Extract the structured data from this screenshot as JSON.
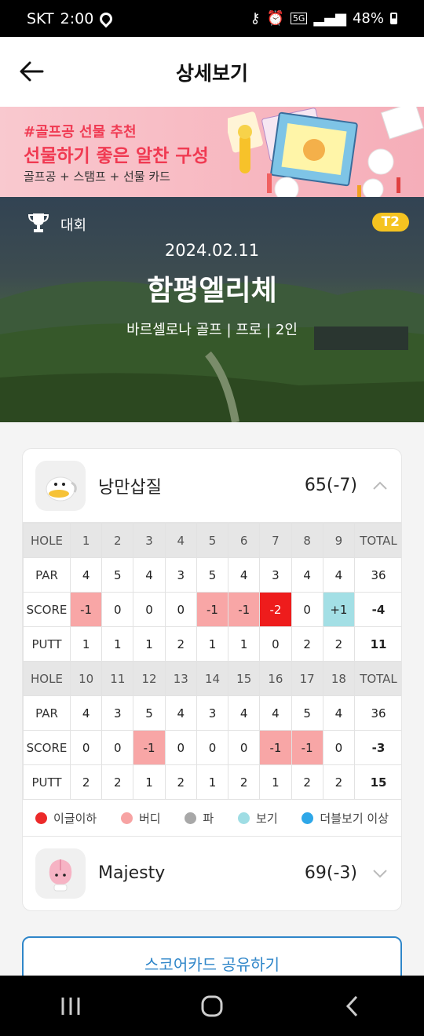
{
  "status_bar": {
    "carrier": "SKT",
    "time": "2:00",
    "network": "5G",
    "battery": "48%"
  },
  "header": {
    "title": "상세보기"
  },
  "banner": {
    "line1": "#골프공 선물 추천",
    "line2": "선물하기 좋은 알찬 구성",
    "line3": "골프공 + 스탬프 + 선물 카드"
  },
  "round": {
    "category": "대회",
    "badge": "T2",
    "date": "2024.02.11",
    "course": "함평엘리체",
    "meta": "바르셀로나 골프  |  프로  |  2인"
  },
  "players": [
    {
      "name": "낭만삽질",
      "score": "65(-7)",
      "expanded": true,
      "front": {
        "holes": [
          "HOLE",
          "1",
          "2",
          "3",
          "4",
          "5",
          "6",
          "7",
          "8",
          "9",
          "TOTAL"
        ],
        "par": [
          "PAR",
          "4",
          "5",
          "4",
          "3",
          "5",
          "4",
          "3",
          "4",
          "4",
          "36"
        ],
        "score": [
          "SCORE",
          "-1",
          "0",
          "0",
          "0",
          "-1",
          "-1",
          "-2",
          "0",
          "+1",
          "-4"
        ],
        "putt": [
          "PUTT",
          "1",
          "1",
          "1",
          "2",
          "1",
          "1",
          "0",
          "2",
          "2",
          "11"
        ]
      },
      "back": {
        "holes": [
          "HOLE",
          "10",
          "11",
          "12",
          "13",
          "14",
          "15",
          "16",
          "17",
          "18",
          "TOTAL"
        ],
        "par": [
          "PAR",
          "4",
          "3",
          "5",
          "4",
          "3",
          "4",
          "4",
          "5",
          "4",
          "36"
        ],
        "score": [
          "SCORE",
          "0",
          "0",
          "-1",
          "0",
          "0",
          "0",
          "-1",
          "-1",
          "0",
          "-3"
        ],
        "putt": [
          "PUTT",
          "2",
          "2",
          "1",
          "2",
          "1",
          "2",
          "1",
          "2",
          "2",
          "15"
        ]
      }
    },
    {
      "name": "Majesty",
      "score": "69(-3)",
      "expanded": false
    }
  ],
  "legend": [
    {
      "label": "이글이하",
      "color": "#ec2a2a"
    },
    {
      "label": "버디",
      "color": "#f7a3a3"
    },
    {
      "label": "파",
      "color": "#a8a8a8"
    },
    {
      "label": "보기",
      "color": "#9fdde4"
    },
    {
      "label": "더블보기 이상",
      "color": "#2ea7e8"
    }
  ],
  "share_button": "스코어카드 공유하기",
  "colors": {
    "eagle": "#ee1c1c",
    "birdie": "#f8a6a6",
    "bogey": "#a3dfe5",
    "accent": "#2f86c9",
    "badge": "#f5c320"
  }
}
